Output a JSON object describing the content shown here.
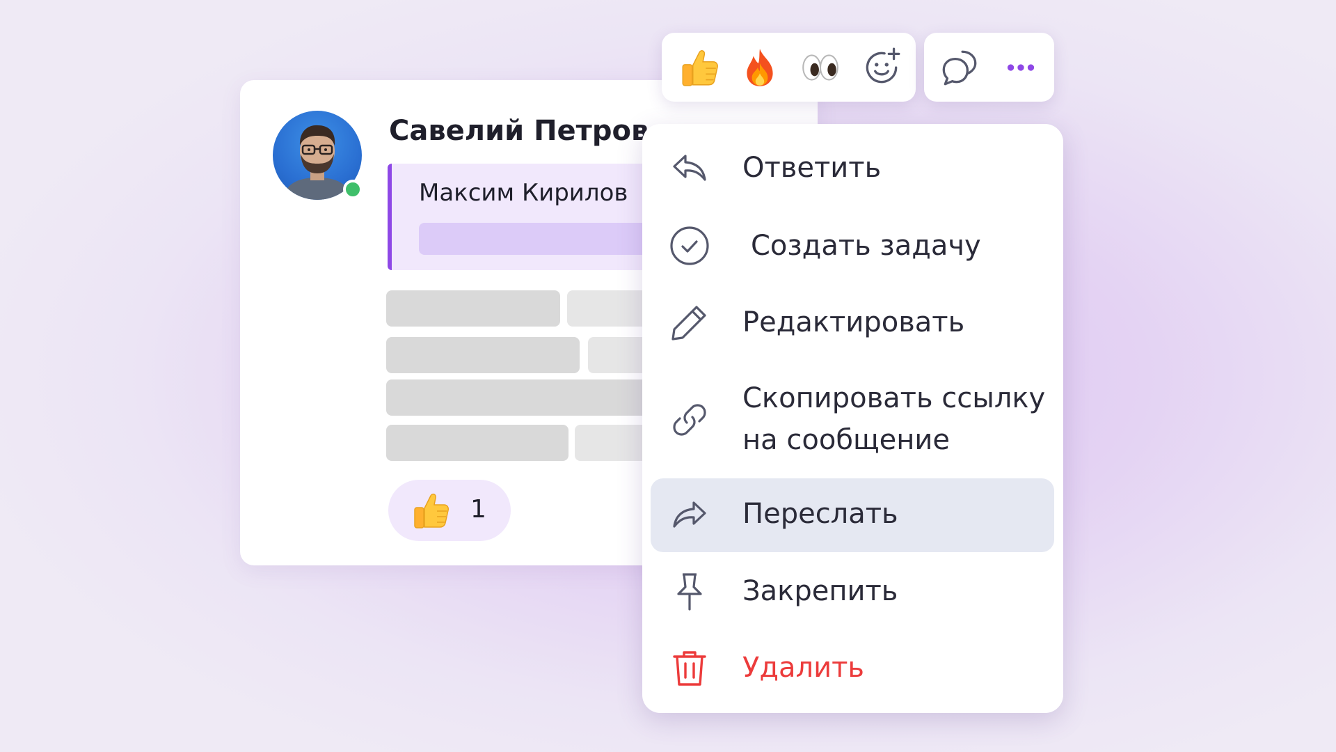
{
  "message": {
    "author": "Савелий Петров",
    "quote_author": "Максим Кирилов",
    "reaction": {
      "icon": "thumbs-up-icon",
      "count": "1"
    },
    "online": true
  },
  "toolbar": {
    "reactions": [
      "thumbs-up-icon",
      "fire-icon",
      "eyes-icon",
      "add-reaction-icon"
    ],
    "actions": [
      "reply-thread-icon",
      "more-icon"
    ]
  },
  "menu": {
    "items": [
      {
        "label": "Ответить",
        "icon": "reply-icon"
      },
      {
        "label": "Создать задачу",
        "icon": "check-circle-icon"
      },
      {
        "label": "Редактировать",
        "icon": "pencil-icon"
      },
      {
        "label_line1": "Скопировать ссылку",
        "label_line2": "на сообщение",
        "icon": "link-icon"
      },
      {
        "label": "Переслать",
        "icon": "forward-icon",
        "highlighted": true
      },
      {
        "label": "Закрепить",
        "icon": "pin-icon"
      },
      {
        "label": "Удалить",
        "icon": "trash-icon",
        "danger": true
      }
    ]
  },
  "colors": {
    "accent": "#8e48e6",
    "danger": "#ec3b3b",
    "online": "#3fbf6a",
    "highlight": "#e5e8f2"
  }
}
